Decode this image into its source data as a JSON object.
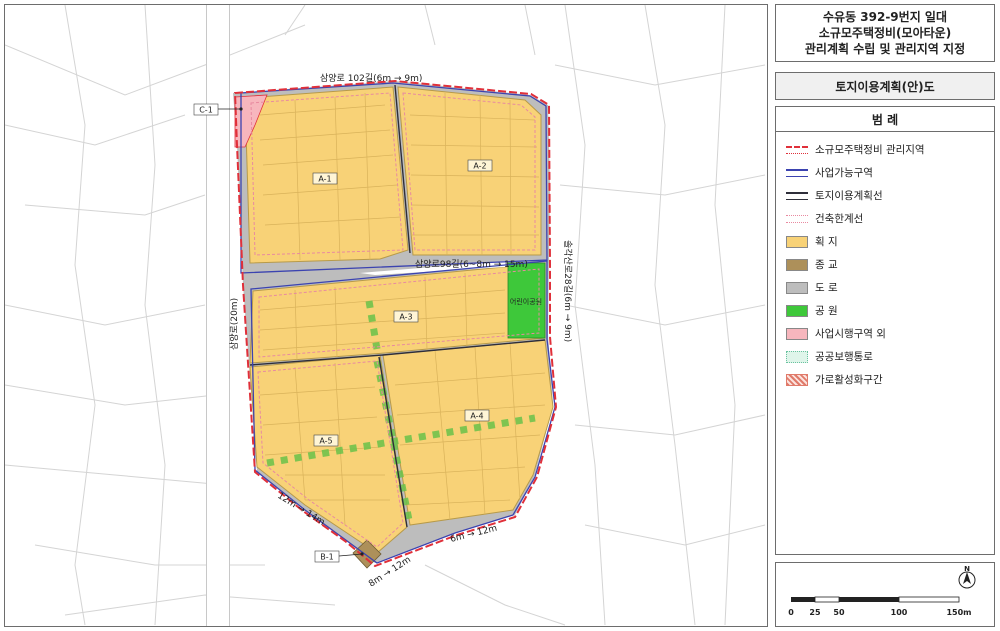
{
  "title": {
    "line1": "수유동 392-9번지 일대",
    "line2": "소규모주택정비(모아타운)",
    "line3": "관리계획 수립 및 관리지역 지정"
  },
  "subtitle": "토지이용계획(안)도",
  "legend": {
    "header": "범  례",
    "items": [
      {
        "label": "소규모주택정비 관리지역",
        "style": "boundary-red-dash",
        "color": "#e0303a"
      },
      {
        "label": "사업가능구역",
        "style": "line-blue",
        "color": "#3b43b0"
      },
      {
        "label": "토지이용계획선",
        "style": "line-dark",
        "color": "#2e2e3a"
      },
      {
        "label": "건축한계선",
        "style": "line-pink-dot",
        "color": "#e88aa0"
      },
      {
        "label": "획 지",
        "style": "fill",
        "color": "#f8d277"
      },
      {
        "label": "종 교",
        "style": "fill",
        "color": "#ad905a"
      },
      {
        "label": "도 로",
        "style": "fill",
        "color": "#bdbdbd"
      },
      {
        "label": "공 원",
        "style": "fill",
        "color": "#3ec83a"
      },
      {
        "label": "사업시행구역 외",
        "style": "fill",
        "color": "#f7b6bd"
      },
      {
        "label": "공공보행통로",
        "style": "fill-dot",
        "color": "#dff5ea"
      },
      {
        "label": "가로활성화구간",
        "style": "hatch",
        "color": "#e07a6a"
      }
    ]
  },
  "map": {
    "blocks": {
      "a1": "A-1",
      "a2": "A-2",
      "a3": "A-3",
      "a4": "A-4",
      "a5": "A-5",
      "b1": "B-1",
      "c1": "C-1"
    },
    "roads": {
      "north": "삼양로 102길(6m → 9m)",
      "middle": "삼양로98길(6~8m → 15m)",
      "west": "삼양로(20m)",
      "east": "솔각산로28길(6m → 9m)",
      "sw": "12m → 14m",
      "south_bottom": "8m → 12m",
      "south_east": "6m → 12m"
    },
    "park_label": "어린이공원"
  },
  "scale": {
    "north_label": "N",
    "ticks": [
      "0",
      "25",
      "50",
      "100",
      "150m"
    ]
  }
}
